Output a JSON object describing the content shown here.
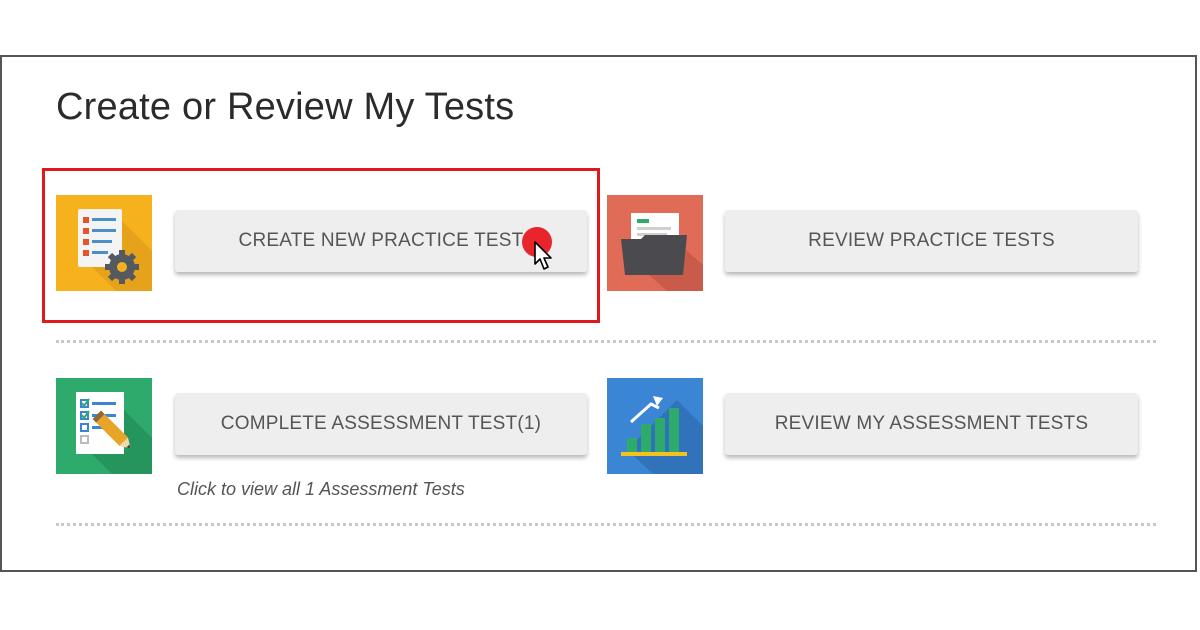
{
  "page": {
    "title": "Create or Review My Tests"
  },
  "actions": [
    {
      "key": "create_practice",
      "label": "CREATE NEW PRACTICE TEST",
      "icon": "practice-test-settings-icon",
      "tile_color": "#f5b21d"
    },
    {
      "key": "review_practice",
      "label": "REVIEW PRACTICE TESTS",
      "icon": "folder-icon",
      "tile_color": "#e06b57"
    },
    {
      "key": "complete_assessment",
      "label": "COMPLETE ASSESSMENT TEST(1)",
      "icon": "checklist-pencil-icon",
      "tile_color": "#2eaa6c"
    },
    {
      "key": "review_assessment",
      "label": "REVIEW MY ASSESSMENT TESTS",
      "icon": "bar-chart-icon",
      "tile_color": "#3b86d4"
    }
  ],
  "assessment_hint": "Click to view all 1 Assessment Tests",
  "colors": {
    "highlight": "#e0191f",
    "click_indicator": "#e8242c",
    "button_bg": "#eeeeee",
    "button_text": "#555555"
  }
}
